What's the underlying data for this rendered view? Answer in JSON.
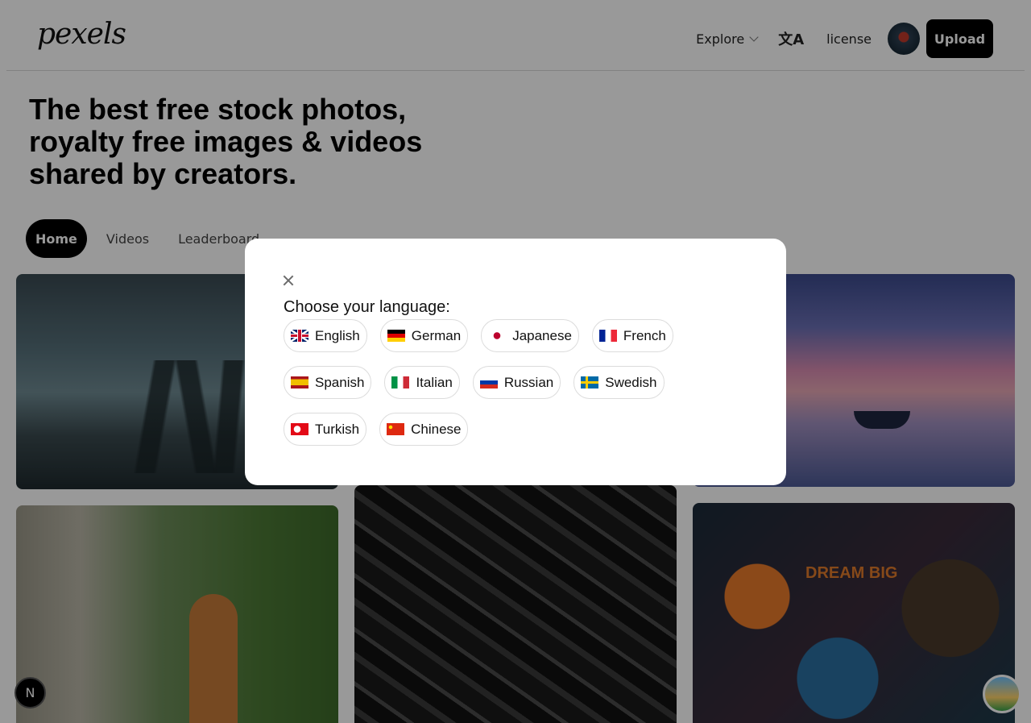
{
  "header": {
    "logo": "pexels",
    "explore_label": "Explore",
    "license_label": "license",
    "upload_label": "Upload"
  },
  "hero": {
    "title": "The best free stock photos, royalty free images & videos shared by creators."
  },
  "tabs": [
    {
      "label": "Home",
      "active": true
    },
    {
      "label": "Videos",
      "active": false
    },
    {
      "label": "Leaderboard",
      "active": false
    }
  ],
  "photos": {
    "art_text": "DREAM BIG"
  },
  "floating": {
    "n_badge": "N"
  },
  "language_modal": {
    "title": "Choose your language:",
    "languages": [
      {
        "label": "English",
        "flag": "flag-uk-icon"
      },
      {
        "label": "German",
        "flag": "flag-germany-icon"
      },
      {
        "label": "Japanese",
        "flag": "flag-japan-icon"
      },
      {
        "label": "French",
        "flag": "flag-france-icon"
      },
      {
        "label": "Spanish",
        "flag": "flag-spain-icon"
      },
      {
        "label": "Italian",
        "flag": "flag-italy-icon"
      },
      {
        "label": "Russian",
        "flag": "flag-russia-icon"
      },
      {
        "label": "Swedish",
        "flag": "flag-sweden-icon"
      },
      {
        "label": "Turkish",
        "flag": "flag-turkey-icon"
      },
      {
        "label": "Chinese",
        "flag": "flag-china-icon"
      }
    ]
  },
  "colors": {
    "overlay": "#000000",
    "upload_bg": "#000000",
    "active_tab_bg": "#000000"
  }
}
